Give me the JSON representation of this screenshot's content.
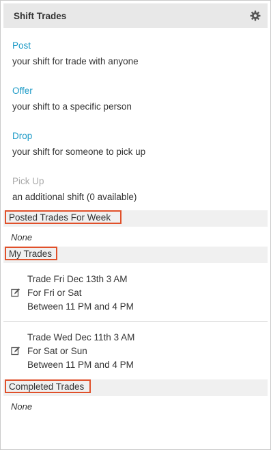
{
  "header": {
    "title": "Shift Trades",
    "settings_icon": "gear-icon"
  },
  "actions": [
    {
      "label": "Post",
      "description": "your shift for trade with anyone",
      "enabled": true
    },
    {
      "label": "Offer",
      "description": "your shift to a specific person",
      "enabled": true
    },
    {
      "label": "Drop",
      "description": "your shift for someone to pick up",
      "enabled": true
    },
    {
      "label": "Pick Up",
      "description": "an additional shift (0 available)",
      "enabled": false
    }
  ],
  "posted_trades": {
    "title": "Posted Trades For Week",
    "empty_text": "None"
  },
  "my_trades": {
    "title": "My Trades",
    "items": [
      {
        "line1": "Trade Fri Dec 13th 3 AM",
        "line2": "For Fri or Sat",
        "line3": "Between 11 PM and 4 PM",
        "icon": "edit-icon"
      },
      {
        "line1": "Trade Wed Dec 11th 3 AM",
        "line2": "For Sat or Sun",
        "line3": "Between 11 PM and 4 PM",
        "icon": "edit-icon"
      }
    ]
  },
  "completed_trades": {
    "title": "Completed Trades",
    "empty_text": "None"
  },
  "colors": {
    "link": "#1e9bc7",
    "disabled_link": "#a9a9a9",
    "highlight_border": "#e0502a",
    "header_bg": "#e8e8e8",
    "section_bg": "#f0f0f0"
  }
}
